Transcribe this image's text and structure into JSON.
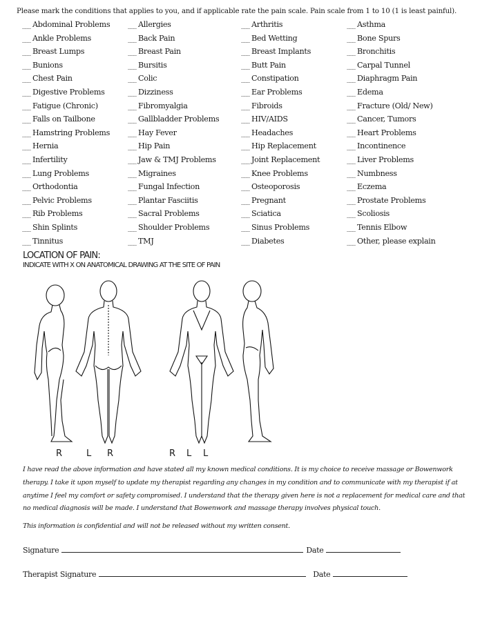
{
  "intro": "Please mark the conditions that applies to you, and if applicable rate the pain scale.  Pain scale from 1 to 10 (1 is least painful).",
  "blank": "___",
  "conditions": [
    "Abdominal Problems",
    "Allergies",
    "Arthritis",
    "Asthma",
    "Ankle Problems",
    "Back Pain",
    "Bed Wetting",
    "Bone Spurs",
    "Breast Lumps",
    "Breast Pain",
    "Breast Implants",
    "Bronchitis",
    "Bunions",
    "Bursitis",
    "Butt Pain",
    "Carpal Tunnel",
    "Chest Pain",
    "Colic",
    "Constipation",
    "Diaphragm Pain",
    "Digestive Problems",
    "Dizziness",
    "Ear Problems",
    "Edema",
    "Fatigue (Chronic)",
    "Fibromyalgia",
    "Fibroids",
    "Fracture (Old/ New)",
    "Falls on Tailbone",
    "Gallbladder Problems",
    "HIV/AIDS",
    " Cancer, Tumors",
    "Hamstring Problems",
    "Hay Fever",
    "Headaches",
    "Heart Problems",
    "Hernia",
    "Hip Pain",
    "Hip Replacement",
    "Incontinence",
    "Infertility",
    "Jaw & TMJ Problems",
    "Joint Replacement",
    "Liver Problems",
    "Lung Problems",
    "Migraines",
    "Knee Problems",
    "Numbness",
    "Orthodontia",
    "Fungal Infection",
    "Osteoporosis",
    "Eczema",
    "Pelvic Problems",
    "Plantar Fasciitis",
    "Pregnant",
    "Prostate Problems",
    "Rib Problems",
    "Sacral Problems",
    "Sciatica",
    "Scoliosis",
    "Shin Splints",
    "Shoulder Problems",
    "Sinus Problems",
    "Tennis Elbow",
    "Tinnitus",
    "TMJ",
    "Diabetes",
    "Other, please explain"
  ],
  "location": {
    "title": "LOCATION OF PAIN:",
    "subtitle": "INDICATE WITH X ON ANATOMICAL DRAWING AT THE SITE OF PAIN",
    "labels": [
      "R",
      "L",
      "R",
      "R",
      "L",
      "L"
    ]
  },
  "consent": "I have read the above information and have stated all my known medical conditions.  It is my choice to receive massage or Bowenwork therapy. I take it upon myself to update my therapist regarding any changes in my condition and to communicate with my therapist if at anytime I feel my comfort or safety compromised.   I understand that the therapy given here is not a replacement for medical care and that no medical diagnosis will be made. I understand that Bowenwork and massage therapy involves physical touch.",
  "confidential": "This information is confidential and will not be released without my written consent.",
  "signature": {
    "client_label": "Signature",
    "therapist_label": "Therapist Signature",
    "date_label": "Date"
  }
}
